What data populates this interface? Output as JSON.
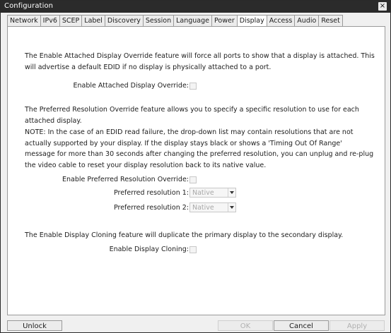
{
  "window": {
    "title": "Configuration",
    "close_glyph": "×"
  },
  "tabs": [
    {
      "label": "Network"
    },
    {
      "label": "IPv6"
    },
    {
      "label": "SCEP"
    },
    {
      "label": "Label"
    },
    {
      "label": "Discovery"
    },
    {
      "label": "Session"
    },
    {
      "label": "Language"
    },
    {
      "label": "Power"
    },
    {
      "label": "Display",
      "active": true
    },
    {
      "label": "Access"
    },
    {
      "label": "Audio"
    },
    {
      "label": "Reset"
    }
  ],
  "display": {
    "attached_desc": [
      "The Enable Attached Display Override feature will force all ports to show that a display is attached. This",
      "will advertise a default EDID if no display is physically attached to a port."
    ],
    "attached_label": "Enable Attached Display Override:",
    "attached_checked": false,
    "preferred_desc": [
      "The Preferred Resolution Override feature allows you to specify a specific resolution to use for each",
      "attached display."
    ],
    "note": [
      "NOTE: In the case of an EDID read failure, the drop-down list may contain resolutions that are not",
      "actually supported by your display. If the display stays black or shows a 'Timing Out Of Range'",
      "message for more than 30 seconds after changing the preferred resolution, you can unplug and re-plug",
      "the video cable to reset your display resolution back to its native value."
    ],
    "preferred_label": "Enable Preferred Resolution Override:",
    "preferred_checked": false,
    "res1_label": "Preferred resolution 1:",
    "res1_value": "Native",
    "res2_label": "Preferred resolution 2:",
    "res2_value": "Native",
    "cloning_desc": "The Enable Display Cloning feature will duplicate the primary display to the secondary display.",
    "cloning_label": "Enable Display Cloning:",
    "cloning_checked": false
  },
  "footer": {
    "unlock": "Unlock",
    "ok": "OK",
    "cancel": "Cancel",
    "apply": "Apply"
  },
  "colors": {
    "titlebar": "#2b2b2b",
    "panel": "#ffffff",
    "window": "#f0f0f0"
  }
}
